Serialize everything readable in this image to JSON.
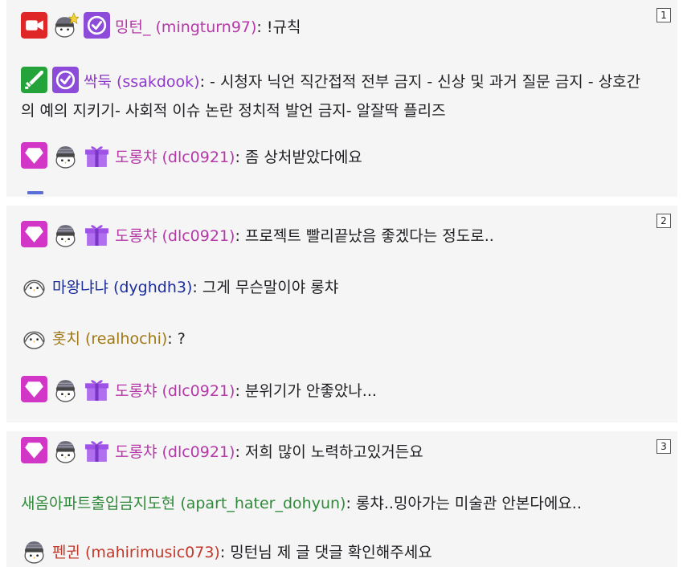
{
  "panels": [
    {
      "number": "1"
    },
    {
      "number": "2"
    },
    {
      "number": "3"
    }
  ],
  "colors": {
    "mingturn": "#b53aa8",
    "ssakdook": "#8f39c9",
    "dlc": "#b53aa8",
    "dyghdh": "#1c2d9e",
    "realhochi": "#a07815",
    "dohyun": "#2f8a3a",
    "mahiri": "#c0392b",
    "camera": "#e02727",
    "verified": "#8c4cd9",
    "sword": "#23a33a",
    "diamond": "#d236c6",
    "gift": "#9f53e6"
  },
  "messages": [
    {
      "user": "밍턴_ (mingturn97)",
      "sep": ": ",
      "text": "!규칙",
      "badges": [
        "camera-icon",
        "penguin-star-icon",
        "verified-icon"
      ]
    },
    {
      "user": "싹둑 (ssakdook)",
      "sep": ": ",
      "text": "- 시청자 닉언 직간접적 전부 금지 - 신상 및 과거 질문 금지 - 상호간의 예의 지키기- 사회적 이슈 논란 정치적 발언 금지- 알잘딱 플리즈",
      "badges": [
        "sword-icon",
        "verified-icon"
      ]
    },
    {
      "user": "도롱챠 (dlc0921)",
      "sep": ": ",
      "text": "좀 상처받았다에요",
      "badges": [
        "diamond-icon",
        "penguin-hat-icon",
        "gift-icon"
      ]
    },
    {
      "user": "도롱챠 (dlc0921)",
      "sep": ": ",
      "text": "프로젝트 빨리끝났음 좋겠다는 정도로..",
      "badges": [
        "diamond-icon",
        "penguin-hat-icon",
        "gift-icon"
      ]
    },
    {
      "user": "마왕냐냐 (dyghdh3)",
      "sep": ": ",
      "text": "그게 무슨말이야 롱챠",
      "badges": [
        "penguin-icon"
      ]
    },
    {
      "user": "홋치 (realhochi)",
      "sep": ": ",
      "text": "?",
      "badges": [
        "penguin-icon"
      ]
    },
    {
      "user": "도롱챠 (dlc0921)",
      "sep": ": ",
      "text": "분위기가 안좋았나...",
      "badges": [
        "diamond-icon",
        "penguin-hat-icon",
        "gift-icon"
      ]
    },
    {
      "user": "도롱챠 (dlc0921)",
      "sep": ": ",
      "text": "저희 많이 노력하고있거든요",
      "badges": [
        "diamond-icon",
        "penguin-hat-icon",
        "gift-icon"
      ]
    },
    {
      "user": "새옴아파트출입금지도현 (apart_hater_dohyun)",
      "sep": ": ",
      "text": "롱챠..밍아가는 미술관 안본다에요..",
      "badges": []
    },
    {
      "user": "펜귄 (mahirimusic073)",
      "sep": ": ",
      "text": "밍턴님 제 글 댓글 확인해주세요",
      "badges": [
        "penguin-hat-icon"
      ]
    }
  ]
}
